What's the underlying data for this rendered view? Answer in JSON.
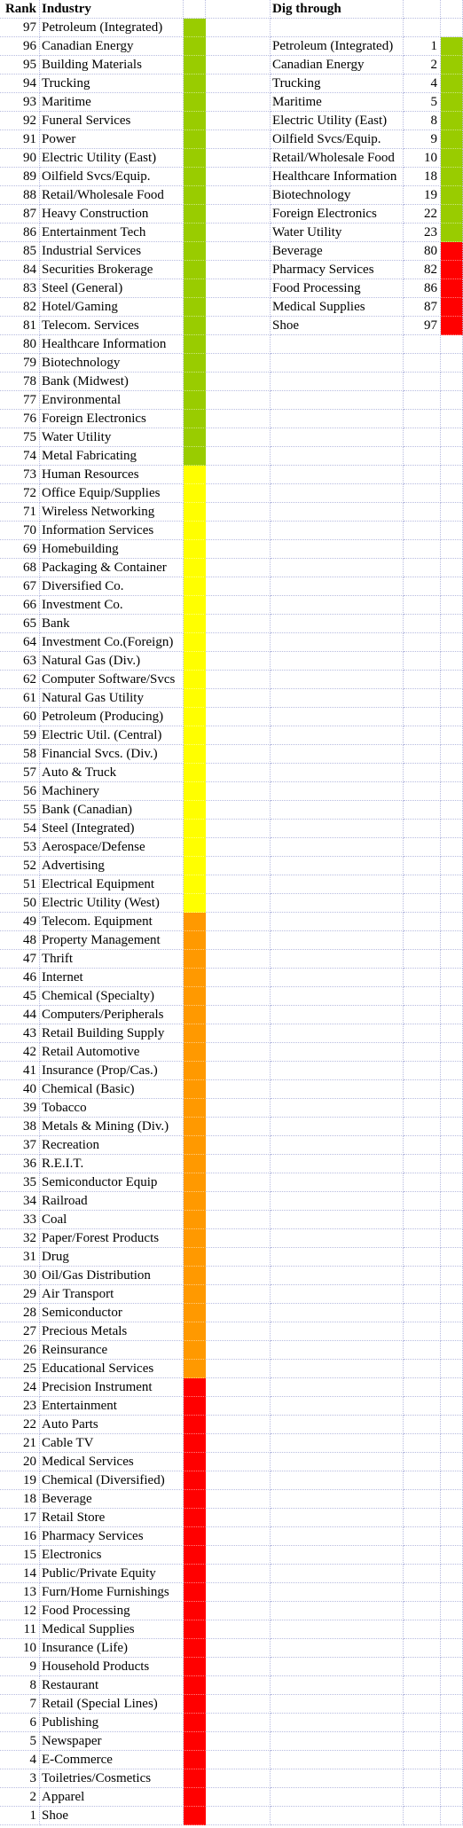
{
  "headers": {
    "rank": "Rank",
    "industry": "Industry",
    "dig": "Dig through"
  },
  "colors": {
    "green": "#99cc00",
    "yellow": "#ffff00",
    "orange": "#ff9900",
    "red": "#ff0000"
  },
  "tiers": [
    {
      "min": 74,
      "max": 97,
      "color": "green"
    },
    {
      "min": 50,
      "max": 73,
      "color": "yellow"
    },
    {
      "min": 25,
      "max": 49,
      "color": "orange"
    },
    {
      "min": 1,
      "max": 24,
      "color": "red"
    }
  ],
  "industries": [
    "Petroleum (Integrated)",
    "Canadian Energy",
    "Building Materials",
    "Trucking",
    "Maritime",
    "Funeral Services",
    "Power",
    "Electric Utility (East)",
    "Oilfield Svcs/Equip.",
    "Retail/Wholesale Food",
    "Heavy Construction",
    "Entertainment Tech",
    "Industrial Services",
    "Securities Brokerage",
    "Steel (General)",
    "Hotel/Gaming",
    "Telecom. Services",
    "Healthcare Information",
    "Biotechnology",
    "Bank (Midwest)",
    "Environmental",
    "Foreign Electronics",
    "Water Utility",
    "Metal Fabricating",
    "Human Resources",
    "Office Equip/Supplies",
    "Wireless Networking",
    "Information Services",
    "Homebuilding",
    "Packaging & Container",
    "Diversified Co.",
    "Investment Co.",
    "Bank",
    "Investment Co.(Foreign)",
    "Natural Gas (Div.)",
    "Computer Software/Svcs",
    "Natural Gas Utility",
    "Petroleum (Producing)",
    "Electric Util. (Central)",
    "Financial Svcs. (Div.)",
    "Auto & Truck",
    "Machinery",
    "Bank (Canadian)",
    "Steel (Integrated)",
    "Aerospace/Defense",
    "Advertising",
    "Electrical Equipment",
    "Electric Utility (West)",
    "Telecom. Equipment",
    "Property Management",
    "Thrift",
    "Internet",
    "Chemical (Specialty)",
    "Computers/Peripherals",
    "Retail Building Supply",
    "Retail Automotive",
    "Insurance (Prop/Cas.)",
    "Chemical (Basic)",
    "Tobacco",
    "Metals & Mining (Div.)",
    "Recreation",
    "R.E.I.T.",
    "Semiconductor Equip",
    "Railroad",
    "Coal",
    "Paper/Forest Products",
    "Drug",
    "Oil/Gas Distribution",
    "Air Transport",
    "Semiconductor",
    "Precious Metals",
    "Reinsurance",
    "Educational Services",
    "Precision Instrument",
    "Entertainment",
    "Auto Parts",
    "Cable TV",
    "Medical Services",
    "Chemical (Diversified)",
    "Beverage",
    "Retail Store",
    "Pharmacy Services",
    "Electronics",
    "Public/Private Equity",
    "Furn/Home Furnishings",
    "Food Processing",
    "Medical Supplies",
    "Insurance (Life)",
    "Household Products",
    "Restaurant",
    "Retail (Special Lines)",
    "Publishing",
    "Newspaper",
    "E-Commerce",
    "Toiletries/Cosmetics",
    "Apparel",
    "Shoe"
  ],
  "dig_through": [
    {
      "name": "Petroleum (Integrated)",
      "value": 1,
      "color": "green"
    },
    {
      "name": "Canadian Energy",
      "value": 2,
      "color": "green"
    },
    {
      "name": "Trucking",
      "value": 4,
      "color": "green"
    },
    {
      "name": "Maritime",
      "value": 5,
      "color": "green"
    },
    {
      "name": "Electric Utility (East)",
      "value": 8,
      "color": "green"
    },
    {
      "name": "Oilfield Svcs/Equip.",
      "value": 9,
      "color": "green"
    },
    {
      "name": "Retail/Wholesale Food",
      "value": 10,
      "color": "green"
    },
    {
      "name": "Healthcare Information",
      "value": 18,
      "color": "green"
    },
    {
      "name": "Biotechnology",
      "value": 19,
      "color": "green"
    },
    {
      "name": "Foreign Electronics",
      "value": 22,
      "color": "green"
    },
    {
      "name": "Water Utility",
      "value": 23,
      "color": "green"
    },
    {
      "name": "Beverage",
      "value": 80,
      "color": "red"
    },
    {
      "name": "Pharmacy Services",
      "value": 82,
      "color": "red"
    },
    {
      "name": "Food Processing",
      "value": 86,
      "color": "red"
    },
    {
      "name": "Medical Supplies",
      "value": 87,
      "color": "red"
    },
    {
      "name": "Shoe",
      "value": 97,
      "color": "red"
    }
  ]
}
